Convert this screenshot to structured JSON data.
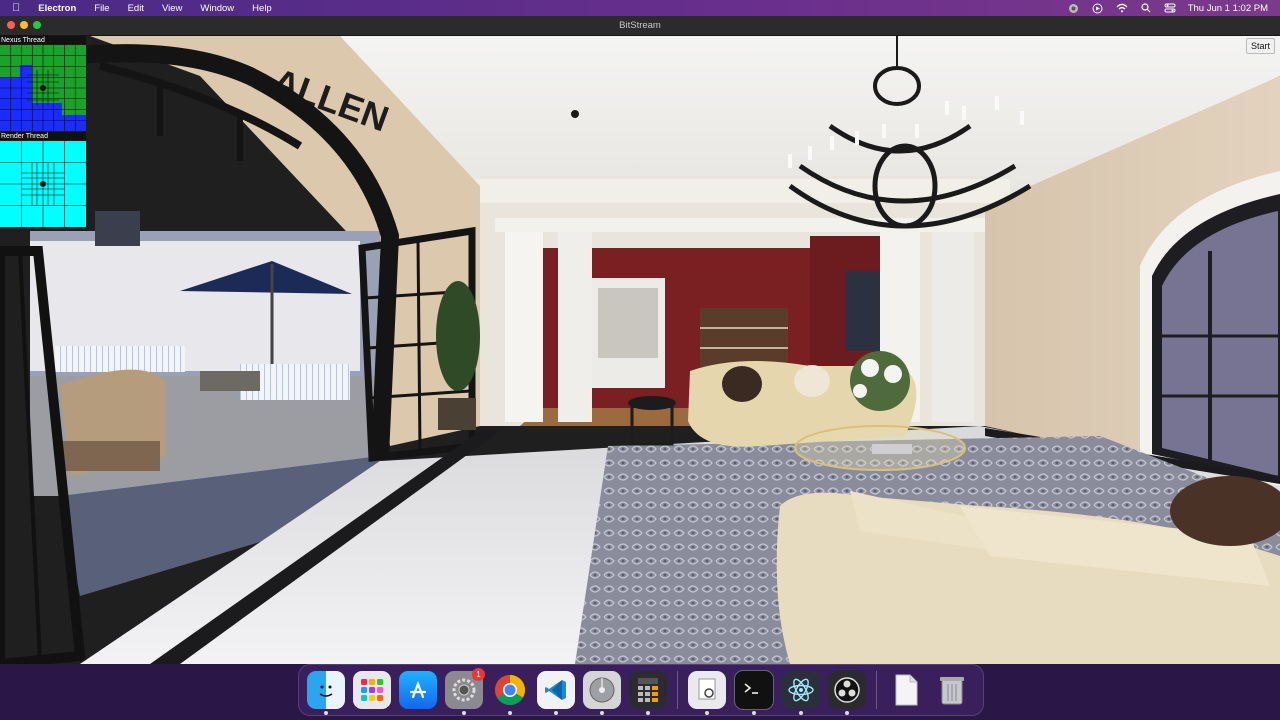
{
  "menubar": {
    "app_name": "Electron",
    "items": [
      "File",
      "Edit",
      "View",
      "Window",
      "Help"
    ],
    "status_icons": [
      "focus-icon",
      "screen-record-icon",
      "wifi-icon",
      "search-icon",
      "control-center-icon"
    ],
    "clock": "Thu Jun 1  1:02 PM"
  },
  "window": {
    "title": "BitStream"
  },
  "stream": {
    "start_label": "Start",
    "nexus_label": "Nexus Thread",
    "render_label": "Render Thread",
    "sign_text": "ALLEN"
  },
  "dock": {
    "apps": [
      {
        "name": "finder-icon",
        "label": "Finder",
        "running": true
      },
      {
        "name": "launchpad-icon",
        "label": "Launchpad",
        "running": false
      },
      {
        "name": "app-store-icon",
        "label": "App Store",
        "running": false
      },
      {
        "name": "system-settings-icon",
        "label": "System Settings",
        "running": true,
        "badge": "1"
      },
      {
        "name": "chrome-icon",
        "label": "Chrome",
        "running": true
      },
      {
        "name": "vscode-icon",
        "label": "VS Code",
        "running": true
      },
      {
        "name": "disk-utility-icon",
        "label": "Disk Utility",
        "running": true
      },
      {
        "name": "calculator-icon",
        "label": "Calculator",
        "running": true
      }
    ],
    "recent": [
      {
        "name": "preview-icon",
        "label": "Preview",
        "running": true
      },
      {
        "name": "terminal-icon",
        "label": "Terminal",
        "running": true
      },
      {
        "name": "electron-icon",
        "label": "Electron",
        "running": true
      },
      {
        "name": "obs-icon",
        "label": "OBS",
        "running": true
      }
    ],
    "other": [
      {
        "name": "documents-icon",
        "label": "Documents"
      },
      {
        "name": "trash-icon",
        "label": "Trash"
      }
    ]
  },
  "colors": {
    "nexus_green": "#1aa32a",
    "nexus_blue": "#1a2cff",
    "render_cyan": "#00ffff",
    "accent_wall": "#7a1f22"
  }
}
